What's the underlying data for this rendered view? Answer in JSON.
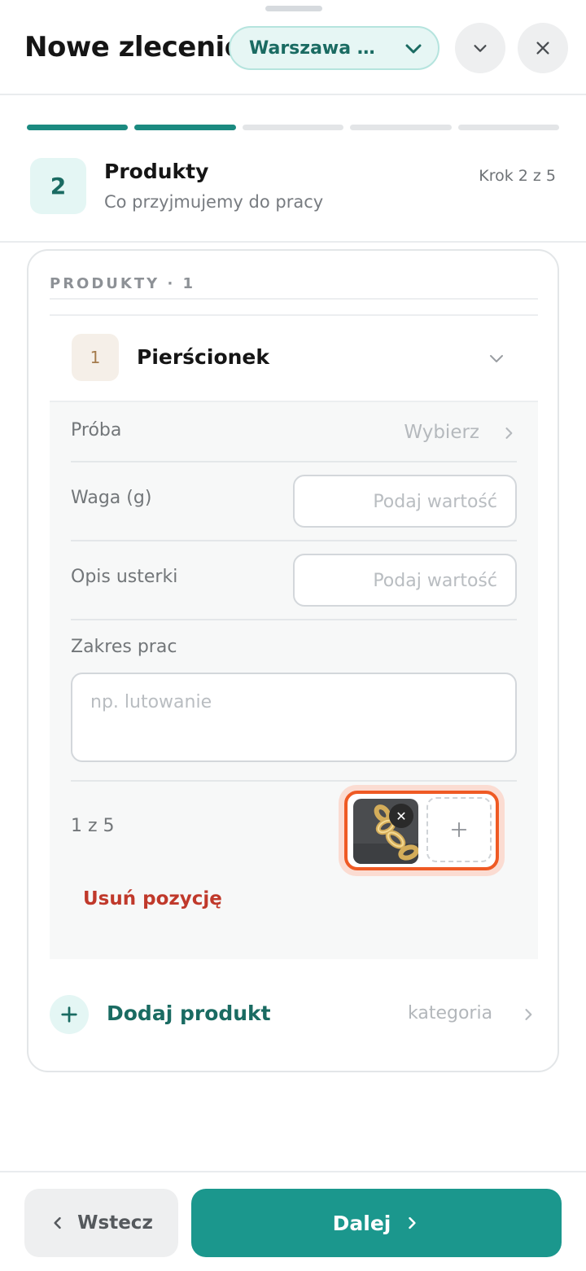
{
  "header": {
    "title": "Nowe zlecenie",
    "branch_selector": "Warszawa Centrum"
  },
  "progress": {
    "total_steps": 5,
    "completed_steps": 2
  },
  "step": {
    "number": "2",
    "title": "Produkty",
    "subtitle": "Co przyjmujemy do pracy",
    "counter": "Krok 2 z 5"
  },
  "products": {
    "section_label": "PRODUKTY · 1",
    "item": {
      "index": "1",
      "name": "Pierścionek",
      "fields": {
        "proba_label": "Próba",
        "proba_value": "Wybierz",
        "waga_label": "Waga (g)",
        "waga_placeholder": "Podaj wartość",
        "opis_label": "Opis usterki",
        "opis_placeholder": "Podaj wartość",
        "zakres_label": "Zakres prac",
        "zakres_placeholder": "np. lutowanie"
      },
      "photos_count": "1 z 5",
      "remove_label": "Usuń pozycję"
    },
    "add_product_label": "Dodaj produkt",
    "add_product_hint": "kategoria"
  },
  "footer": {
    "back_label": "Wstecz",
    "next_label": "Dalej"
  },
  "colors": {
    "accent": "#1b978d",
    "accent_dark": "#1a6b62",
    "danger": "#c0392b",
    "highlight": "#ef5a24"
  }
}
